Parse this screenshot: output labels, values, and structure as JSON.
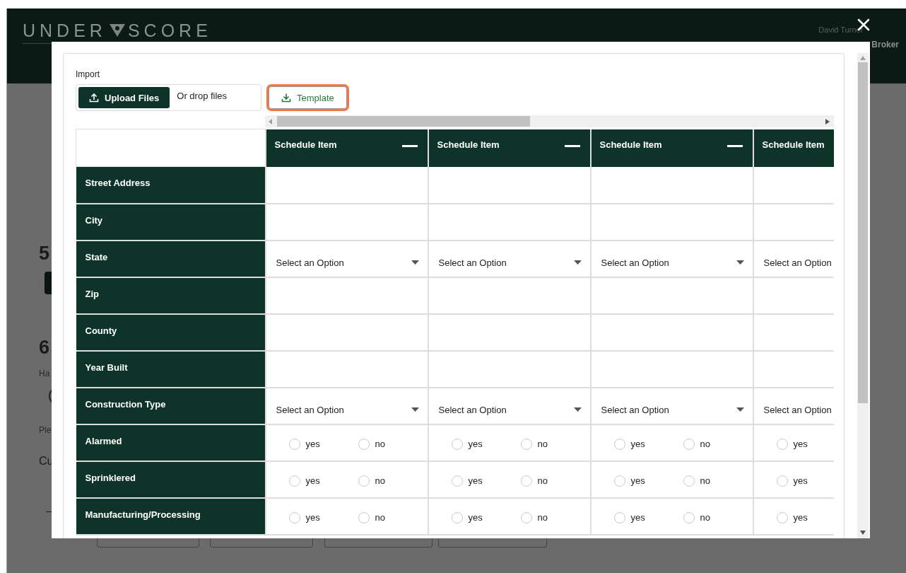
{
  "header": {
    "logo_left": "UNDER",
    "logo_right": "SCORE",
    "user_name": "David Turner",
    "role": "Broker"
  },
  "background": [
    {
      "kind": "heading",
      "text": "5"
    },
    {
      "kind": "button"
    },
    {
      "kind": "heading",
      "text": "6"
    },
    {
      "kind": "text",
      "text": "Ha"
    },
    {
      "kind": "radio",
      "selected": false
    },
    {
      "kind": "text",
      "text": "Ple"
    },
    {
      "kind": "large",
      "text": "Cu"
    },
    {
      "kind": "dash"
    },
    {
      "kind": "fields"
    }
  ],
  "modal": {
    "import_label": "Import",
    "upload_button": "Upload Files",
    "drop_hint": "Or drop files",
    "template_button": "Template",
    "template_focused": true
  },
  "columns": [
    {
      "title": "Schedule Item"
    },
    {
      "title": "Schedule Item"
    },
    {
      "title": "Schedule Item"
    },
    {
      "title": "Schedule Item"
    }
  ],
  "rows": [
    {
      "label": "Street Address",
      "kind": "text"
    },
    {
      "label": "City",
      "kind": "text"
    },
    {
      "label": "State",
      "kind": "select",
      "cells": [
        {
          "value": "Select an Option"
        },
        {
          "value": "Select an Option"
        },
        {
          "value": "Select an Option"
        },
        {
          "value": "Select an Option"
        }
      ]
    },
    {
      "label": "Zip",
      "kind": "text"
    },
    {
      "label": "County",
      "kind": "text"
    },
    {
      "label": "Year Built",
      "kind": "text"
    },
    {
      "label": "Construction Type",
      "kind": "select",
      "cells": [
        {
          "value": "Select an Option"
        },
        {
          "value": "Select an Option"
        },
        {
          "value": "Select an Option"
        },
        {
          "value": "Select an Option"
        }
      ]
    },
    {
      "label": "Alarmed",
      "kind": "radio",
      "cells": [
        {
          "options": [
            {
              "label": "yes",
              "selected": false
            },
            {
              "label": "no",
              "selected": false
            }
          ]
        },
        {
          "options": [
            {
              "label": "yes",
              "selected": false
            },
            {
              "label": "no",
              "selected": false
            }
          ]
        },
        {
          "options": [
            {
              "label": "yes",
              "selected": false
            },
            {
              "label": "no",
              "selected": false
            }
          ]
        },
        {
          "options": [
            {
              "label": "yes",
              "selected": false
            }
          ]
        }
      ]
    },
    {
      "label": "Sprinklered",
      "kind": "radio",
      "cells": [
        {
          "options": [
            {
              "label": "yes",
              "selected": false
            },
            {
              "label": "no",
              "selected": false
            }
          ]
        },
        {
          "options": [
            {
              "label": "yes",
              "selected": false
            },
            {
              "label": "no",
              "selected": false
            }
          ]
        },
        {
          "options": [
            {
              "label": "yes",
              "selected": false
            },
            {
              "label": "no",
              "selected": false
            }
          ]
        },
        {
          "options": [
            {
              "label": "yes",
              "selected": false
            }
          ]
        }
      ]
    },
    {
      "label": "Manufacturing/Processing",
      "kind": "radio",
      "cells": [
        {
          "options": [
            {
              "label": "yes",
              "selected": false
            },
            {
              "label": "no",
              "selected": false
            }
          ]
        },
        {
          "options": [
            {
              "label": "yes",
              "selected": false
            },
            {
              "label": "no",
              "selected": false
            }
          ]
        },
        {
          "options": [
            {
              "label": "yes",
              "selected": false
            },
            {
              "label": "no",
              "selected": false
            }
          ]
        },
        {
          "options": [
            {
              "label": "yes",
              "selected": false
            }
          ]
        }
      ]
    }
  ]
}
